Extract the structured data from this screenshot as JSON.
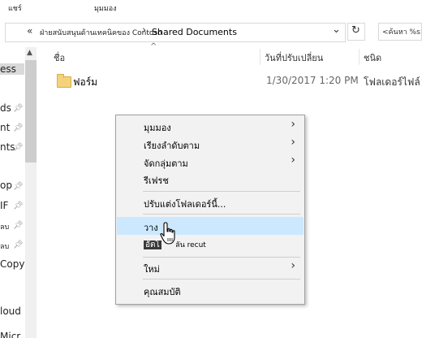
{
  "ribbon": {
    "tab_share": "แชร์",
    "tab_view": "มุมมอง"
  },
  "address": {
    "back_glyph": "«",
    "parent_segment": "ฝ่ายสนับสนุนด้านเทคนิคของ Contoso",
    "separator": "›",
    "current_segment": "Shared Documents",
    "dropdown_glyph": "⌄",
    "refresh_glyph": "↻",
    "search_placeholder": "<ค้นหา %s>"
  },
  "nav": {
    "items": [
      "ess",
      "ds",
      "nt",
      "nts",
      "op",
      "IF",
      "ลบ",
      "ลบ",
      "CopyF",
      "loud",
      "Micr"
    ]
  },
  "columns": {
    "name": "ชื่อ",
    "modified": "วันที่ปรับเปลี่ยน",
    "type": "ชนิด",
    "sort_glyph": "^"
  },
  "files": [
    {
      "name": "ฟอร์ม",
      "modified": "1/30/2017 1:20 PM",
      "type": "โฟลเดอร์ไฟล์"
    }
  ],
  "context_menu": {
    "view": "มุมมอง",
    "sort_by": "เรียงลำดับตาม",
    "group_by": "จัดกลุ่มตาม",
    "refresh": "รีเฟรช",
    "customize": "ปรับแต่งโฟลเดอร์นี้...",
    "paste": "วาง",
    "paste_shortcut_sel": "อัตโ",
    "paste_shortcut_rest": "ลัน recut",
    "new": "ใหม่",
    "properties": "คุณสมบัติ",
    "arrow_glyph": "›"
  },
  "colors": {
    "highlight": "#cce8ff",
    "menu_bg": "#f2f2f2",
    "folder": "#f3d27a"
  },
  "icons": [
    "folder-icon",
    "back-icon",
    "dropdown-icon",
    "refresh-icon",
    "pin-icon",
    "hand-cursor-icon",
    "chevron-right-icon"
  ]
}
